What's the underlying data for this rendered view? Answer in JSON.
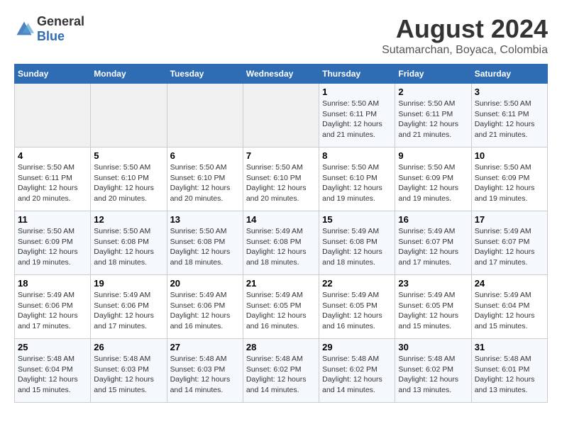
{
  "logo": {
    "general": "General",
    "blue": "Blue"
  },
  "title": "August 2024",
  "subtitle": "Sutamarchan, Boyaca, Colombia",
  "headers": [
    "Sunday",
    "Monday",
    "Tuesday",
    "Wednesday",
    "Thursday",
    "Friday",
    "Saturday"
  ],
  "weeks": [
    [
      {
        "day": "",
        "info": ""
      },
      {
        "day": "",
        "info": ""
      },
      {
        "day": "",
        "info": ""
      },
      {
        "day": "",
        "info": ""
      },
      {
        "day": "1",
        "info": "Sunrise: 5:50 AM\nSunset: 6:11 PM\nDaylight: 12 hours\nand 21 minutes."
      },
      {
        "day": "2",
        "info": "Sunrise: 5:50 AM\nSunset: 6:11 PM\nDaylight: 12 hours\nand 21 minutes."
      },
      {
        "day": "3",
        "info": "Sunrise: 5:50 AM\nSunset: 6:11 PM\nDaylight: 12 hours\nand 21 minutes."
      }
    ],
    [
      {
        "day": "4",
        "info": "Sunrise: 5:50 AM\nSunset: 6:11 PM\nDaylight: 12 hours\nand 20 minutes."
      },
      {
        "day": "5",
        "info": "Sunrise: 5:50 AM\nSunset: 6:10 PM\nDaylight: 12 hours\nand 20 minutes."
      },
      {
        "day": "6",
        "info": "Sunrise: 5:50 AM\nSunset: 6:10 PM\nDaylight: 12 hours\nand 20 minutes."
      },
      {
        "day": "7",
        "info": "Sunrise: 5:50 AM\nSunset: 6:10 PM\nDaylight: 12 hours\nand 20 minutes."
      },
      {
        "day": "8",
        "info": "Sunrise: 5:50 AM\nSunset: 6:10 PM\nDaylight: 12 hours\nand 19 minutes."
      },
      {
        "day": "9",
        "info": "Sunrise: 5:50 AM\nSunset: 6:09 PM\nDaylight: 12 hours\nand 19 minutes."
      },
      {
        "day": "10",
        "info": "Sunrise: 5:50 AM\nSunset: 6:09 PM\nDaylight: 12 hours\nand 19 minutes."
      }
    ],
    [
      {
        "day": "11",
        "info": "Sunrise: 5:50 AM\nSunset: 6:09 PM\nDaylight: 12 hours\nand 19 minutes."
      },
      {
        "day": "12",
        "info": "Sunrise: 5:50 AM\nSunset: 6:08 PM\nDaylight: 12 hours\nand 18 minutes."
      },
      {
        "day": "13",
        "info": "Sunrise: 5:50 AM\nSunset: 6:08 PM\nDaylight: 12 hours\nand 18 minutes."
      },
      {
        "day": "14",
        "info": "Sunrise: 5:49 AM\nSunset: 6:08 PM\nDaylight: 12 hours\nand 18 minutes."
      },
      {
        "day": "15",
        "info": "Sunrise: 5:49 AM\nSunset: 6:08 PM\nDaylight: 12 hours\nand 18 minutes."
      },
      {
        "day": "16",
        "info": "Sunrise: 5:49 AM\nSunset: 6:07 PM\nDaylight: 12 hours\nand 17 minutes."
      },
      {
        "day": "17",
        "info": "Sunrise: 5:49 AM\nSunset: 6:07 PM\nDaylight: 12 hours\nand 17 minutes."
      }
    ],
    [
      {
        "day": "18",
        "info": "Sunrise: 5:49 AM\nSunset: 6:06 PM\nDaylight: 12 hours\nand 17 minutes."
      },
      {
        "day": "19",
        "info": "Sunrise: 5:49 AM\nSunset: 6:06 PM\nDaylight: 12 hours\nand 17 minutes."
      },
      {
        "day": "20",
        "info": "Sunrise: 5:49 AM\nSunset: 6:06 PM\nDaylight: 12 hours\nand 16 minutes."
      },
      {
        "day": "21",
        "info": "Sunrise: 5:49 AM\nSunset: 6:05 PM\nDaylight: 12 hours\nand 16 minutes."
      },
      {
        "day": "22",
        "info": "Sunrise: 5:49 AM\nSunset: 6:05 PM\nDaylight: 12 hours\nand 16 minutes."
      },
      {
        "day": "23",
        "info": "Sunrise: 5:49 AM\nSunset: 6:05 PM\nDaylight: 12 hours\nand 15 minutes."
      },
      {
        "day": "24",
        "info": "Sunrise: 5:49 AM\nSunset: 6:04 PM\nDaylight: 12 hours\nand 15 minutes."
      }
    ],
    [
      {
        "day": "25",
        "info": "Sunrise: 5:48 AM\nSunset: 6:04 PM\nDaylight: 12 hours\nand 15 minutes."
      },
      {
        "day": "26",
        "info": "Sunrise: 5:48 AM\nSunset: 6:03 PM\nDaylight: 12 hours\nand 15 minutes."
      },
      {
        "day": "27",
        "info": "Sunrise: 5:48 AM\nSunset: 6:03 PM\nDaylight: 12 hours\nand 14 minutes."
      },
      {
        "day": "28",
        "info": "Sunrise: 5:48 AM\nSunset: 6:02 PM\nDaylight: 12 hours\nand 14 minutes."
      },
      {
        "day": "29",
        "info": "Sunrise: 5:48 AM\nSunset: 6:02 PM\nDaylight: 12 hours\nand 14 minutes."
      },
      {
        "day": "30",
        "info": "Sunrise: 5:48 AM\nSunset: 6:02 PM\nDaylight: 12 hours\nand 13 minutes."
      },
      {
        "day": "31",
        "info": "Sunrise: 5:48 AM\nSunset: 6:01 PM\nDaylight: 12 hours\nand 13 minutes."
      }
    ]
  ]
}
